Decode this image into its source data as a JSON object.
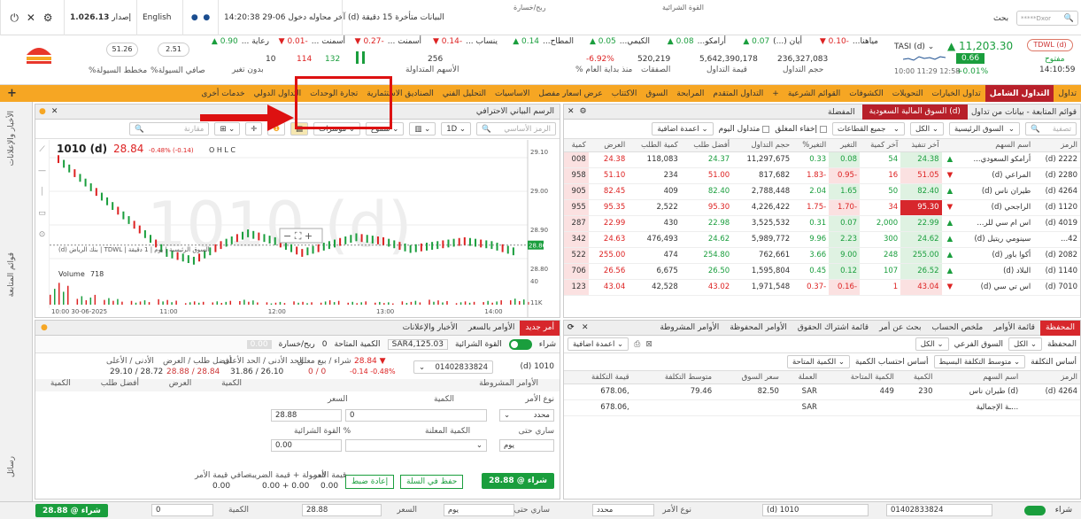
{
  "topbar": {
    "search_label": "بحث",
    "search_user": "*****Dxor",
    "version_label": "إصدار",
    "version": "1.026.13",
    "language": "English",
    "last_login": "آخر محاوله دخول 06-29 14:20:38",
    "data_delay": "(d) البيانات متأخرة 15 دقيقة",
    "profit_label": "ربح/خسارة",
    "buying_power": "القوة الشرائية"
  },
  "ticker": {
    "symbol": "TDWL (d)",
    "status": "مفتوح",
    "time": "14:10:59",
    "index_name": "TASI (d)",
    "index_value": "▲ 11,203.30",
    "index_change": "0.66",
    "index_change_pct": "+0.01%",
    "session": "10:00 11:29 12:58",
    "vol_value": "236,327,083",
    "vol_label": "حجم التداول",
    "trade_value": "5,642,390,178",
    "trade_value_label": "قيمة التداول",
    "deals": "520,219",
    "deals_label": "الصفقات",
    "ytd": "-6.92%",
    "ytd_label": "% منذ بداية العام",
    "traded_count": "256",
    "traded_label": "الأسهم المتداولة",
    "up": "132",
    "down": "114",
    "unchanged": "10",
    "nochange_label": "بدون تغير",
    "liq_net": "2.51",
    "liq_label": "%صافي السيولة",
    "liq_avg": "51.26",
    "liq_avg_label": "%مخطط السيولة",
    "tickers": [
      {
        "name": "مياهنا...",
        "chg": "-0.10 ▼"
      },
      {
        "name": "أيان (...)",
        "chg": "0.07 ▲"
      },
      {
        "name": "أرامكو...",
        "chg": "0.08 ▲"
      },
      {
        "name": "الكيمي...",
        "chg": "0.05 ▲"
      },
      {
        "name": "المطاح...",
        "chg": "0.14 ▲"
      },
      {
        "name": "ينساب ...",
        "chg": "-0.14 ▼"
      },
      {
        "name": "أسمنت ...",
        "chg": "-0.27 ▼"
      },
      {
        "name": "أسمنت ...",
        "chg": "-0.01 ▼"
      },
      {
        "name": "رعاية ...",
        "chg": "0.90 ▲"
      }
    ]
  },
  "nav": {
    "items": [
      "تداول",
      "التداول الشامل",
      "تداول الخيارات",
      "التحويلات",
      "الكشوفات",
      "القوائم الشرعية",
      "+",
      "التداول المتقدم",
      "المرابحة",
      "السوق",
      "الاكتتاب",
      "عرض اسعار مفصل",
      "الاساسيات",
      "التحليل الفني",
      "الصناديق الاستثمارية",
      "تجارة الوحدات",
      "التداول الدولي",
      "خدمات أخرى"
    ],
    "active_index": 1
  },
  "sidebar": {
    "labels": [
      "الأخبار والإعلانات",
      "قوائم المتابعة",
      "رسائل"
    ]
  },
  "watchlist": {
    "header_title": "قوائم المتابعة - بيانات من تداول",
    "tab_active": "السوق المالية السعودية (d)",
    "tab_fav": "المفضلة",
    "filter_placeholder": "تصفية",
    "market_select": "السوق الرئيسية",
    "all_select": "الكل",
    "sector_select": "جميع القطاعات",
    "hide_closed": "إخفاء المغلق",
    "traded_today": "متداول اليوم",
    "add_column": "اعمدة اضافية",
    "columns": [
      "الرمز",
      "اسم السهم",
      "",
      "آخر تنفيذ",
      "آخر كمية",
      "التغير",
      "التغير%",
      "حجم التداول",
      "أفضل طلب",
      "كمية الطلب",
      "العرض",
      "كمية"
    ],
    "rows": [
      {
        "sym": "2222 (d)",
        "name": "أرامكو السعودي...",
        "dir": "▲",
        "last": "24.38",
        "qty": "54",
        "chg": "0.08",
        "pct": "0.33",
        "vol": "11,297,675",
        "bid": "24.37",
        "bidq": "118,083",
        "ask": "24.38",
        "askq": "008"
      },
      {
        "sym": "2280 (d)",
        "name": "المراعي (d)",
        "dir": "▼",
        "last": "51.05",
        "qty": "16",
        "chg": "-0.95",
        "pct": "-1.83",
        "vol": "817,682",
        "bid": "51.00",
        "bidq": "234",
        "ask": "51.10",
        "askq": "958"
      },
      {
        "sym": "4264 (d)",
        "name": "طيران ناس (d)",
        "dir": "▲",
        "last": "82.40",
        "qty": "50",
        "chg": "1.65",
        "pct": "2.04",
        "vol": "2,788,448",
        "bid": "82.40",
        "bidq": "409",
        "ask": "82.45",
        "askq": "905"
      },
      {
        "sym": "1120 (d)",
        "name": "الراجحي (d)",
        "dir": "▼",
        "last": "95.30",
        "qty": "34",
        "chg": "-1.70",
        "pct": "-1.75",
        "vol": "4,226,422",
        "bid": "95.30",
        "bidq": "2,522",
        "ask": "95.35",
        "askq": "955"
      },
      {
        "sym": "4019 (d)",
        "name": "اس ام سي للر...",
        "dir": "▲",
        "last": "22.99",
        "qty": "2,000",
        "chg": "0.07",
        "pct": "0.31",
        "vol": "3,525,532",
        "bid": "22.98",
        "bidq": "430",
        "ask": "22.99",
        "askq": "287"
      },
      {
        "sym": "42...",
        "name": "سينومي ريتيل (d)",
        "dir": "▲",
        "last": "24.62",
        "qty": "300",
        "chg": "2.23",
        "pct": "9.96",
        "vol": "5,989,772",
        "bid": "24.62",
        "bidq": "476,493",
        "ask": "24.63",
        "askq": "342"
      },
      {
        "sym": "2082 (d)",
        "name": "أكوا باور (d)",
        "dir": "▲",
        "last": "255.00",
        "qty": "248",
        "chg": "9.00",
        "pct": "3.66",
        "vol": "762,661",
        "bid": "254.80",
        "bidq": "474",
        "ask": "255.00",
        "askq": "522"
      },
      {
        "sym": "1140 (d)",
        "name": "البلاد (d)",
        "dir": "▲",
        "last": "26.52",
        "qty": "107",
        "chg": "0.12",
        "pct": "0.45",
        "vol": "1,595,804",
        "bid": "26.50",
        "bidq": "6,675",
        "ask": "26.56",
        "askq": "706"
      },
      {
        "sym": "7010 (d)",
        "name": "اس تي سي (d)",
        "dir": "▼",
        "last": "43.04",
        "qty": "1",
        "chg": "-0.16",
        "pct": "-0.37",
        "vol": "1,971,548",
        "bid": "43.02",
        "bidq": "42,528",
        "ask": "43.04",
        "askq": "123"
      }
    ]
  },
  "chart": {
    "panel_title": "الرسم البياني الاحترافي",
    "symbol_placeholder": "الرمز الأساسي",
    "compare_placeholder": "مقارنة",
    "interval": "1D",
    "type": "شموع",
    "indicators": "مؤشرات",
    "symbol": "1010 (d)",
    "price": "28.84",
    "change": "-0.48% (-0.14)",
    "ohlc": "O  H  L  C",
    "watermark": "1010 (d)",
    "meta": "(d) بنك الرياض | TDWL | السوق الرئيسية | يوم | 1 دقيقة",
    "volume_label": "Volume",
    "volume_value": "718",
    "y_labels": [
      "29.10",
      "29.00",
      "28.90",
      "28.80"
    ],
    "vol_labels": [
      "40",
      "11K"
    ],
    "x_labels": [
      "10:00\n30-06-2025",
      "11:00",
      "12:00",
      "13:00",
      "14:00"
    ],
    "last_tag": "28.86"
  },
  "chart_data": {
    "type": "line",
    "title": "1010 (d)",
    "x": [
      "10:00",
      "10:15",
      "10:30",
      "10:45",
      "11:00",
      "11:15",
      "11:30",
      "11:45",
      "12:00",
      "12:15",
      "12:30",
      "12:45",
      "13:00",
      "13:15",
      "13:30",
      "13:45",
      "14:00",
      "14:10"
    ],
    "series": [
      {
        "name": "1010 (d)",
        "values": [
          29.08,
          29.02,
          28.96,
          28.9,
          28.84,
          28.82,
          28.86,
          28.89,
          28.87,
          28.84,
          28.86,
          28.88,
          28.87,
          28.85,
          28.86,
          28.87,
          28.86,
          28.84
        ]
      }
    ],
    "volume": [
      40,
      18,
      12,
      8,
      10,
      6,
      7,
      9,
      5,
      6,
      8,
      6,
      5,
      7,
      9,
      6,
      8,
      11
    ],
    "ylim": [
      28.78,
      29.12
    ],
    "grid": true
  },
  "orders": {
    "new_order": "أمر جديد",
    "tab_orders": "الأوامر بالسعر",
    "tab_news": "الأخبار والإعلانات",
    "buy_label": "شراء",
    "buying_power_label": "القوة الشرائية",
    "buying_power": "SAR4,125.03",
    "avail_qty_label": "الكمية المتاحة",
    "avail_qty": "0",
    "pl_label": "ربح/خسارة",
    "pl_value": "0.00",
    "symbol": "(d) 1010",
    "account": "01402833824",
    "last_price": "28.84 ▼",
    "last_change": "-0.14 -0.48%",
    "buysell_label": "شراء / بيع معلق",
    "buysell_value": "0 / 0",
    "lowhigh_label": "الحد الأدنى / الحد الأعلى",
    "lowhigh_value": "31.86 / 26.10",
    "bestbid_label": "أفضل طلب / العرض",
    "bestbid_value": "28.88 / 28.84",
    "daylow_label": "الأدنى / الأعلى",
    "daylow_value": "29.10 / 28.72",
    "conditional": "الأوامر المشروطة",
    "order_type_label": "نوع الأمر",
    "order_type": "محدد",
    "qty_label": "الكمية",
    "price_label": "السعر",
    "price_value": "28.88",
    "qty_value": "0",
    "valid_label": "ساري حتى",
    "valid_value": "يوم",
    "shown_qty_label": "الكمية المعلنة",
    "bp_pct_label": "القوة الشرائية %",
    "bp_pct_value": "0.00",
    "order_value_label": "قيمة الأمر",
    "order_value": "0.00",
    "commission_label": "العمولة + قيمة الضريبة",
    "commission_value": "0.00 + 0.00",
    "net_label": "صافي قيمة الأمر",
    "net_value": "0.00",
    "buy_btn": "شراء @ 28.88",
    "cart_btn": "حفظ في السلة",
    "reset_btn": "إعادة ضبط",
    "book_headers": [
      "الكمية",
      "العرض",
      "أفضل طلب",
      "الكمية"
    ]
  },
  "portfolio": {
    "tabs": [
      "المحفظة",
      "قائمة الأوامر",
      "ملخص الحساب",
      "بحث عن أمر",
      "قائمة اشتراك الحقوق",
      "الأوامر المحفوظة",
      "الأوامر المشروطة"
    ],
    "wallet_label": "المحفظة",
    "wallet_value": "الكل",
    "market_label": "السوق الفرعي",
    "market_value": "الكل",
    "add_columns": "اعمدة اضافية",
    "cost_basis_label": "أساس التكلفة",
    "cost_basis_value": "متوسط التكلفة البسيط",
    "qty_basis_label": "أساس احتساب الكمية",
    "qty_basis_value": "الكمية المتاحة",
    "columns": [
      "الرمز",
      "اسم السهم",
      "الكمية",
      "الكمية المتاحة",
      "العملة",
      "سعر السوق",
      "متوسط التكلفة",
      "قيمة التكلفة"
    ],
    "rows": [
      {
        "sym": "4264 (d)",
        "name": "(d) طيران ناس",
        "qty": "230",
        "avail": "449",
        "cur": "SAR",
        "mkt": "82.50",
        "avg": "79.46",
        "cost": ",678.06"
      },
      {
        "sym": "",
        "name": "...ـة الإجمالية",
        "qty": "",
        "avail": "",
        "cur": "SAR",
        "mkt": "",
        "avg": "",
        "cost": ",678.06"
      }
    ]
  },
  "bottom": {
    "buy": "شراء",
    "account": "01402833824",
    "symbol": "(d) 1010",
    "order_type_label": "نوع الأمر",
    "order_type": "محدد",
    "valid_label": "ساري حتى",
    "valid": "يوم",
    "price_label": "السعر",
    "price": "28.88",
    "qty_label": "الكمية",
    "qty": "0",
    "buy_btn": "شراء @ 28.88"
  },
  "colors": {
    "accent": "#f6a623",
    "brand": "#b8202a",
    "up": "#1a9e3d",
    "down": "#d22"
  }
}
